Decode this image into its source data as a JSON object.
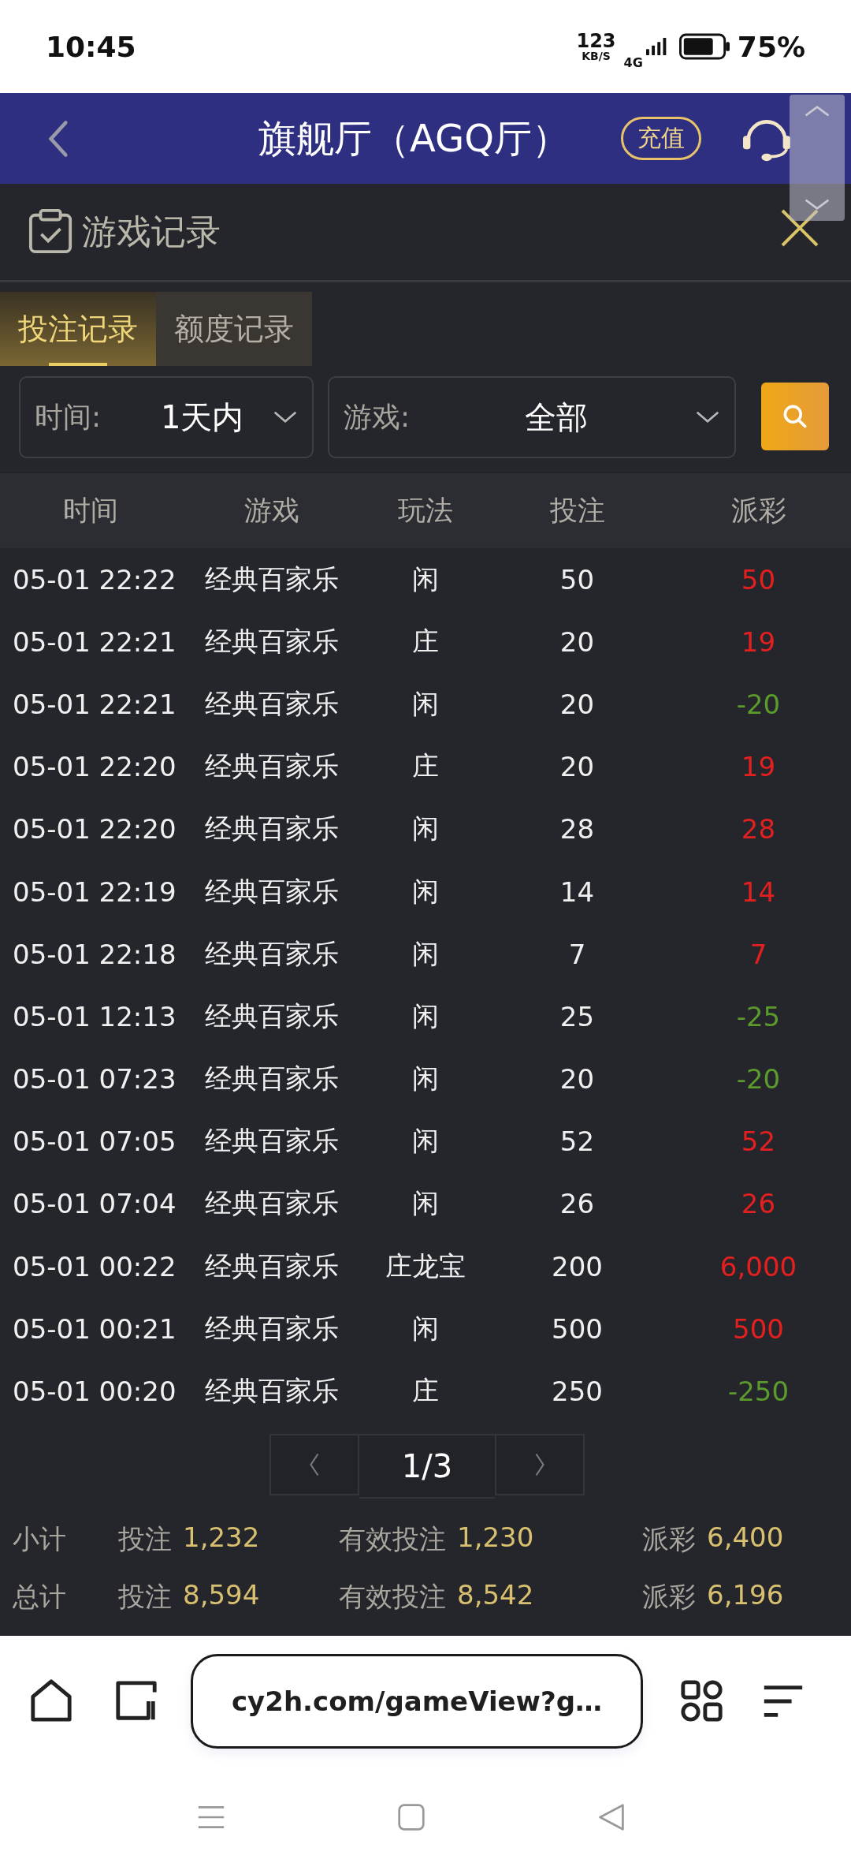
{
  "status_bar": {
    "time": "10:45",
    "net_speed": "123",
    "net_unit": "KB/S",
    "network": "4G",
    "battery": "75%"
  },
  "header": {
    "title": "旗舰厅（AGQ厅）",
    "recharge_button": "充值"
  },
  "panel": {
    "title": "游戏记录"
  },
  "tabs": [
    {
      "label": "投注记录",
      "selected": true
    },
    {
      "label": "额度记录",
      "selected": false
    }
  ],
  "filters": [
    {
      "label": "时间:",
      "value": "1天内"
    },
    {
      "label": "游戏:",
      "value": "全部"
    }
  ],
  "table": {
    "columns": [
      "时间",
      "游戏",
      "玩法",
      "投注",
      "派彩"
    ],
    "rows": [
      {
        "time": "05-01 22:22",
        "game": "经典百家乐",
        "bet_type": "闲",
        "bet": "50",
        "payout": "50",
        "color": "#e3201f"
      },
      {
        "time": "05-01 22:21",
        "game": "经典百家乐",
        "bet_type": "庄",
        "bet": "20",
        "payout": "19",
        "color": "#e3201f"
      },
      {
        "time": "05-01 22:21",
        "game": "经典百家乐",
        "bet_type": "闲",
        "bet": "20",
        "payout": "-20",
        "color": "#5b9a2c"
      },
      {
        "time": "05-01 22:20",
        "game": "经典百家乐",
        "bet_type": "庄",
        "bet": "20",
        "payout": "19",
        "color": "#e3201f"
      },
      {
        "time": "05-01 22:20",
        "game": "经典百家乐",
        "bet_type": "闲",
        "bet": "28",
        "payout": "28",
        "color": "#e3201f"
      },
      {
        "time": "05-01 22:19",
        "game": "经典百家乐",
        "bet_type": "闲",
        "bet": "14",
        "payout": "14",
        "color": "#e3201f"
      },
      {
        "time": "05-01 22:18",
        "game": "经典百家乐",
        "bet_type": "闲",
        "bet": "7",
        "payout": "7",
        "color": "#e3201f"
      },
      {
        "time": "05-01 12:13",
        "game": "经典百家乐",
        "bet_type": "闲",
        "bet": "25",
        "payout": "-25",
        "color": "#5b9a2c"
      },
      {
        "time": "05-01 07:23",
        "game": "经典百家乐",
        "bet_type": "闲",
        "bet": "20",
        "payout": "-20",
        "color": "#5b9a2c"
      },
      {
        "time": "05-01 07:05",
        "game": "经典百家乐",
        "bet_type": "闲",
        "bet": "52",
        "payout": "52",
        "color": "#e3201f"
      },
      {
        "time": "05-01 07:04",
        "game": "经典百家乐",
        "bet_type": "闲",
        "bet": "26",
        "payout": "26",
        "color": "#e3201f"
      },
      {
        "time": "05-01 00:22",
        "game": "经典百家乐",
        "bet_type": "庄龙宝",
        "bet": "200",
        "payout": "6,000",
        "color": "#e3201f"
      },
      {
        "time": "05-01 00:21",
        "game": "经典百家乐",
        "bet_type": "闲",
        "bet": "500",
        "payout": "500",
        "color": "#e3201f"
      },
      {
        "time": "05-01 00:20",
        "game": "经典百家乐",
        "bet_type": "庄",
        "bet": "250",
        "payout": "-250",
        "color": "#5b9a2c"
      }
    ]
  },
  "pagination": {
    "page": "1/3"
  },
  "summary": [
    {
      "label": "小计",
      "items": [
        {
          "label": "投注",
          "value": "1,232"
        },
        {
          "label": "有效投注",
          "value": "1,230"
        },
        {
          "label": "派彩",
          "value": "6,400"
        }
      ]
    },
    {
      "label": "总计",
      "items": [
        {
          "label": "投注",
          "value": "8,594"
        },
        {
          "label": "有效投注",
          "value": "8,542"
        },
        {
          "label": "派彩",
          "value": "6,196"
        }
      ]
    }
  ],
  "browser": {
    "url": "cy2h.com/gameView?g…"
  }
}
